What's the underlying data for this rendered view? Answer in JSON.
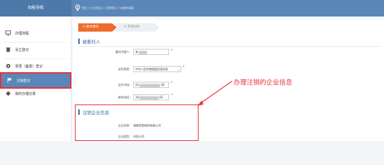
{
  "header": {
    "nav_title": "功能导航",
    "breadcrumb": [
      "首页",
      "企业登记",
      "注销登记",
      "创建申请表"
    ]
  },
  "sidebar": {
    "items": [
      {
        "label": "办理流程",
        "icon": "monitor-icon"
      },
      {
        "label": "设立登记",
        "icon": "trash-icon"
      },
      {
        "label": "变更（备案）登记",
        "icon": "gear-icon"
      },
      {
        "label": "注销登记",
        "icon": "flag-icon",
        "active": true
      },
      {
        "label": "我的办理记录",
        "icon": "diamond-icon"
      }
    ]
  },
  "steps": [
    {
      "label": "① 基本情况",
      "active": true
    },
    {
      "label": "② 申请材料",
      "active": false
    }
  ],
  "sections": {
    "agent": {
      "title": "被委托人",
      "fields": [
        {
          "label": "委托代理人：",
          "value": "李",
          "required": true
        },
        {
          "label": "证件类型：",
          "value": "中华人民共和国居民身份证",
          "required": true
        },
        {
          "label": "证件号码：",
          "value": "43",
          "value_tail": "39",
          "required": true
        },
        {
          "label": "联系电话：",
          "value": "18",
          "value_tail": "83",
          "required": true
        }
      ]
    },
    "company": {
      "title": "注销企业信息",
      "fields": [
        {
          "label": "企业名称：",
          "value": "湖南荷堂商贸有限公司"
        },
        {
          "label": "企业类型：",
          "value": "内资公司"
        }
      ]
    }
  },
  "annotation": "办理注销的企业信息",
  "colors": {
    "header": "#5a87b8",
    "accent": "#ef6b2d",
    "annotation_red": "#e8303a",
    "section_blue": "#3a6ea5"
  }
}
